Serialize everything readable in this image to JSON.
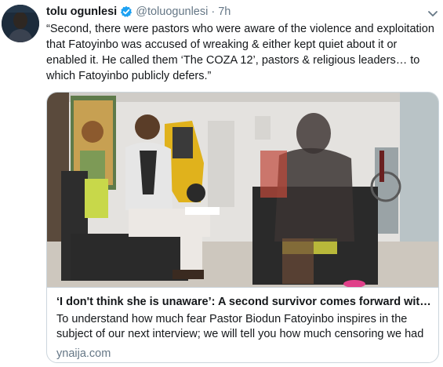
{
  "tweet": {
    "author_name": "tolu ogunlesi",
    "handle": "@toluogunlesi",
    "separator": "·",
    "time": "7h",
    "text": "“Second, there were pastors who were aware of the violence and exploitation that Fatoyinbo was accused of wreaking & either kept quiet about it or enabled it. He called them ‘The COZA 12’, pastors & religious leaders… to which Fatoyinbo publicly defers.”"
  },
  "card": {
    "title": "‘I don't think she is unaware’: A second survivor comes forward with...",
    "description": "To understand how much fear Pastor Biodun Fatoyinbo inspires in the subject of our next interview; we will tell you how much censoring we had t...",
    "domain": "ynaija.com"
  },
  "colors": {
    "verified_badge": "#1da1f2",
    "secondary_text": "#657786",
    "border": "#ccd6dd"
  },
  "icons": {
    "verified": "verified-badge-icon",
    "caret": "chevron-down-icon"
  }
}
